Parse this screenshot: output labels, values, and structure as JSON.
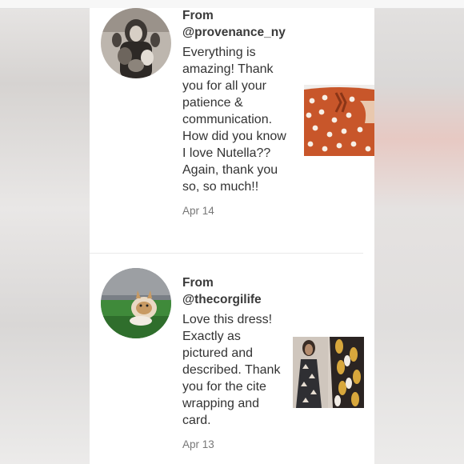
{
  "reviews": [
    {
      "from_label": "From",
      "handle": "@provenance_ny",
      "body": "Everything is amazing! Thank you for all your patience & communication. How did you know I love Nutella?? Again, thank you so, so much!!",
      "date": "Apr 14"
    },
    {
      "from_label": "From",
      "handle": "@thecorgilife",
      "body": "Love this dress! Exactly as pictured and described. Thank you for the cite wrapping and card.",
      "date": "Apr 13"
    }
  ],
  "colors": {
    "panel_background": "#ffffff",
    "text": "#333333",
    "date_text": "#777777",
    "divider": "#e9e9e9"
  },
  "icons": [
    "user-avatar",
    "corgi-avatar",
    "polka-dot-pants-photo",
    "patterned-dress-photo"
  ]
}
